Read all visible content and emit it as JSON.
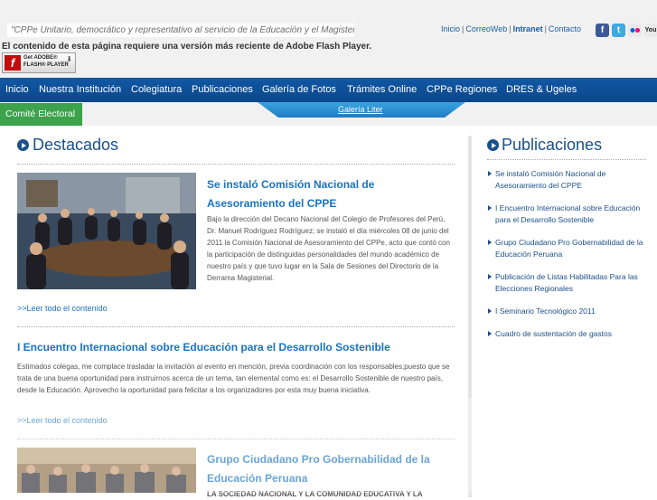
{
  "header": {
    "slogan": "\"CPPe Unitario, democrático y representativo al servicio de la Educación y el Magisterio\"",
    "flash_notice": "El contenido de esta página requiere una versión más reciente de Adobe Flash Player.",
    "flash_button": {
      "line1": "Get ADOBE®",
      "line2": "FLASH® PLAYER"
    },
    "top_links": [
      {
        "label": "Inicio"
      },
      {
        "label": "CorreoWeb"
      },
      {
        "label": "Intranet"
      },
      {
        "label": "Contacto"
      }
    ],
    "social_icons": [
      "facebook-icon",
      "twitter-icon",
      "flickr-icon",
      "youtube-icon"
    ],
    "youtube_label": "You"
  },
  "nav": {
    "items": [
      "Inicio",
      "Nuestra Institución",
      "Colegiatura",
      "Publicaciones",
      "Galería de Fotos",
      "Trámites Online",
      "CPPe Regiones",
      "DRES & Ugeles"
    ],
    "comite": "Comité Electoral",
    "gallery_link": "Galería Liter"
  },
  "colors": {
    "nav_blue": "#0b4789",
    "green": "#3ca24b",
    "heading_blue": "#1b4f8a",
    "link_blue": "#1a73c2"
  },
  "destacados": {
    "heading": "Destacados",
    "articles": [
      {
        "title": "Se instaló Comisión Nacional de Asesoramiento del CPPE",
        "body": "Bajo la dirección del Decano Nacional del Colegio de Profesores del Perú, Dr. Manuel Rodríguez Rodríguez; se instaló el día miércoles 08 de junio del 2011 la Comisión Nacional de Asesoramiento del CPPe, acto que contó con la participación de distinguidas personalidades del mundo académico de nuestro país y que tuvo lugar en la Sala de Sesiones del Directorio de la Derrama Magisterial.",
        "more": ">>Leer todo el contenido"
      },
      {
        "title": "I Encuentro Internacional sobre Educación para el Desarrollo Sostenible",
        "body": "Estimados colegas, me complace trasladar la invitación al evento en mención, previa coordinación con los responsables;puesto que se trata de una buena oportunidad para instruirnos acerca de un tema, tan elemental como es: el Desarrollo Sostenible de nuestro país, desde la Educación. Aprovecho la oportunidad para felicitar a los organizadores por esta muy buena iniciativa.",
        "more": ">>Leer todo el contenido"
      },
      {
        "title": "Grupo Ciudadano Pro Gobernabilidad de la Educación Peruana",
        "body": "LA SOCIEDAD NACIONAL Y LA COMUNIDAD EDUCATIVA Y LA"
      }
    ]
  },
  "publicaciones": {
    "heading": "Publicaciones",
    "items": [
      "Se instaló Comisión Nacional de Asesoramiento del CPPE",
      "I Encuentro Internacional sobre Educación para el Desarrollo Sostenible",
      "Grupo Ciudadano Pro Gobernabilidad de la Educación Peruana",
      "Publicación de Listas Habilitadas Para las Elecciones Regionales",
      "I Seminario Tecnológico 2011",
      "Cuadro de sustentación de gastos"
    ]
  }
}
